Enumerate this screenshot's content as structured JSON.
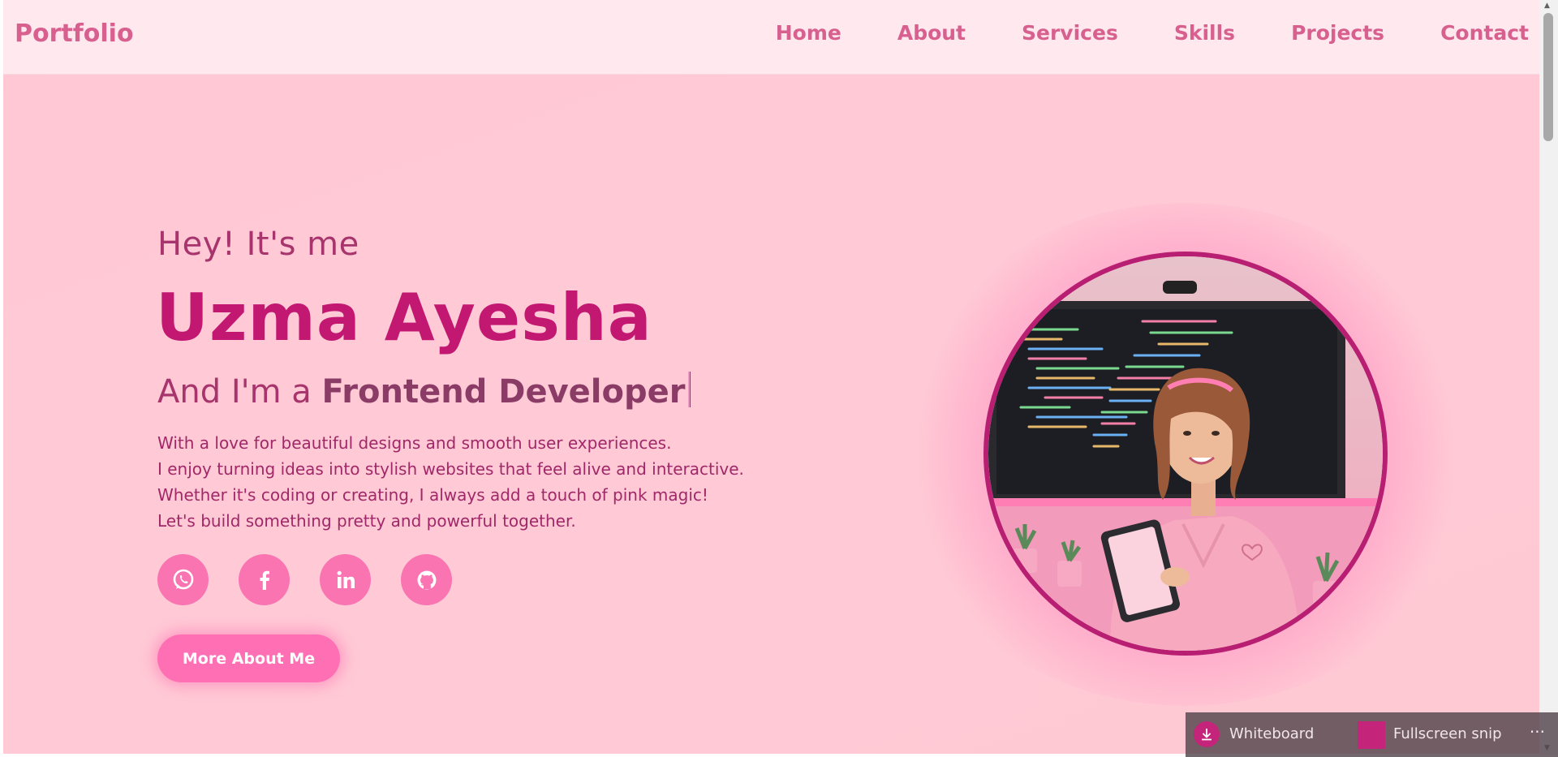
{
  "nav": {
    "logo": "Portfolio",
    "links": [
      "Home",
      "About",
      "Services",
      "Skills",
      "Projects",
      "Contact"
    ]
  },
  "hero": {
    "greeting": "Hey! It's me",
    "name": "Uzma Ayesha",
    "role_prefix": "And I'm a ",
    "role": "Frontend Developer",
    "bio": [
      "With a love for beautiful designs and smooth user experiences.",
      "I enjoy turning ideas into stylish websites that feel alive and interactive.",
      "Whether it's coding or creating, I always add a touch of pink magic!",
      "Let's build something pretty and powerful together."
    ],
    "socials": [
      "whatsapp-icon",
      "facebook-icon",
      "linkedin-icon",
      "github-icon"
    ],
    "cta_label": "More About Me"
  },
  "snipbar": {
    "whiteboard_label": "Whiteboard",
    "fullscreen_label": "Fullscreen snip",
    "more_label": "···"
  },
  "colors": {
    "accent": "#c21872",
    "nav_text": "#d8608f",
    "button": "#ff6fb4",
    "background": "#ffc9d4"
  }
}
